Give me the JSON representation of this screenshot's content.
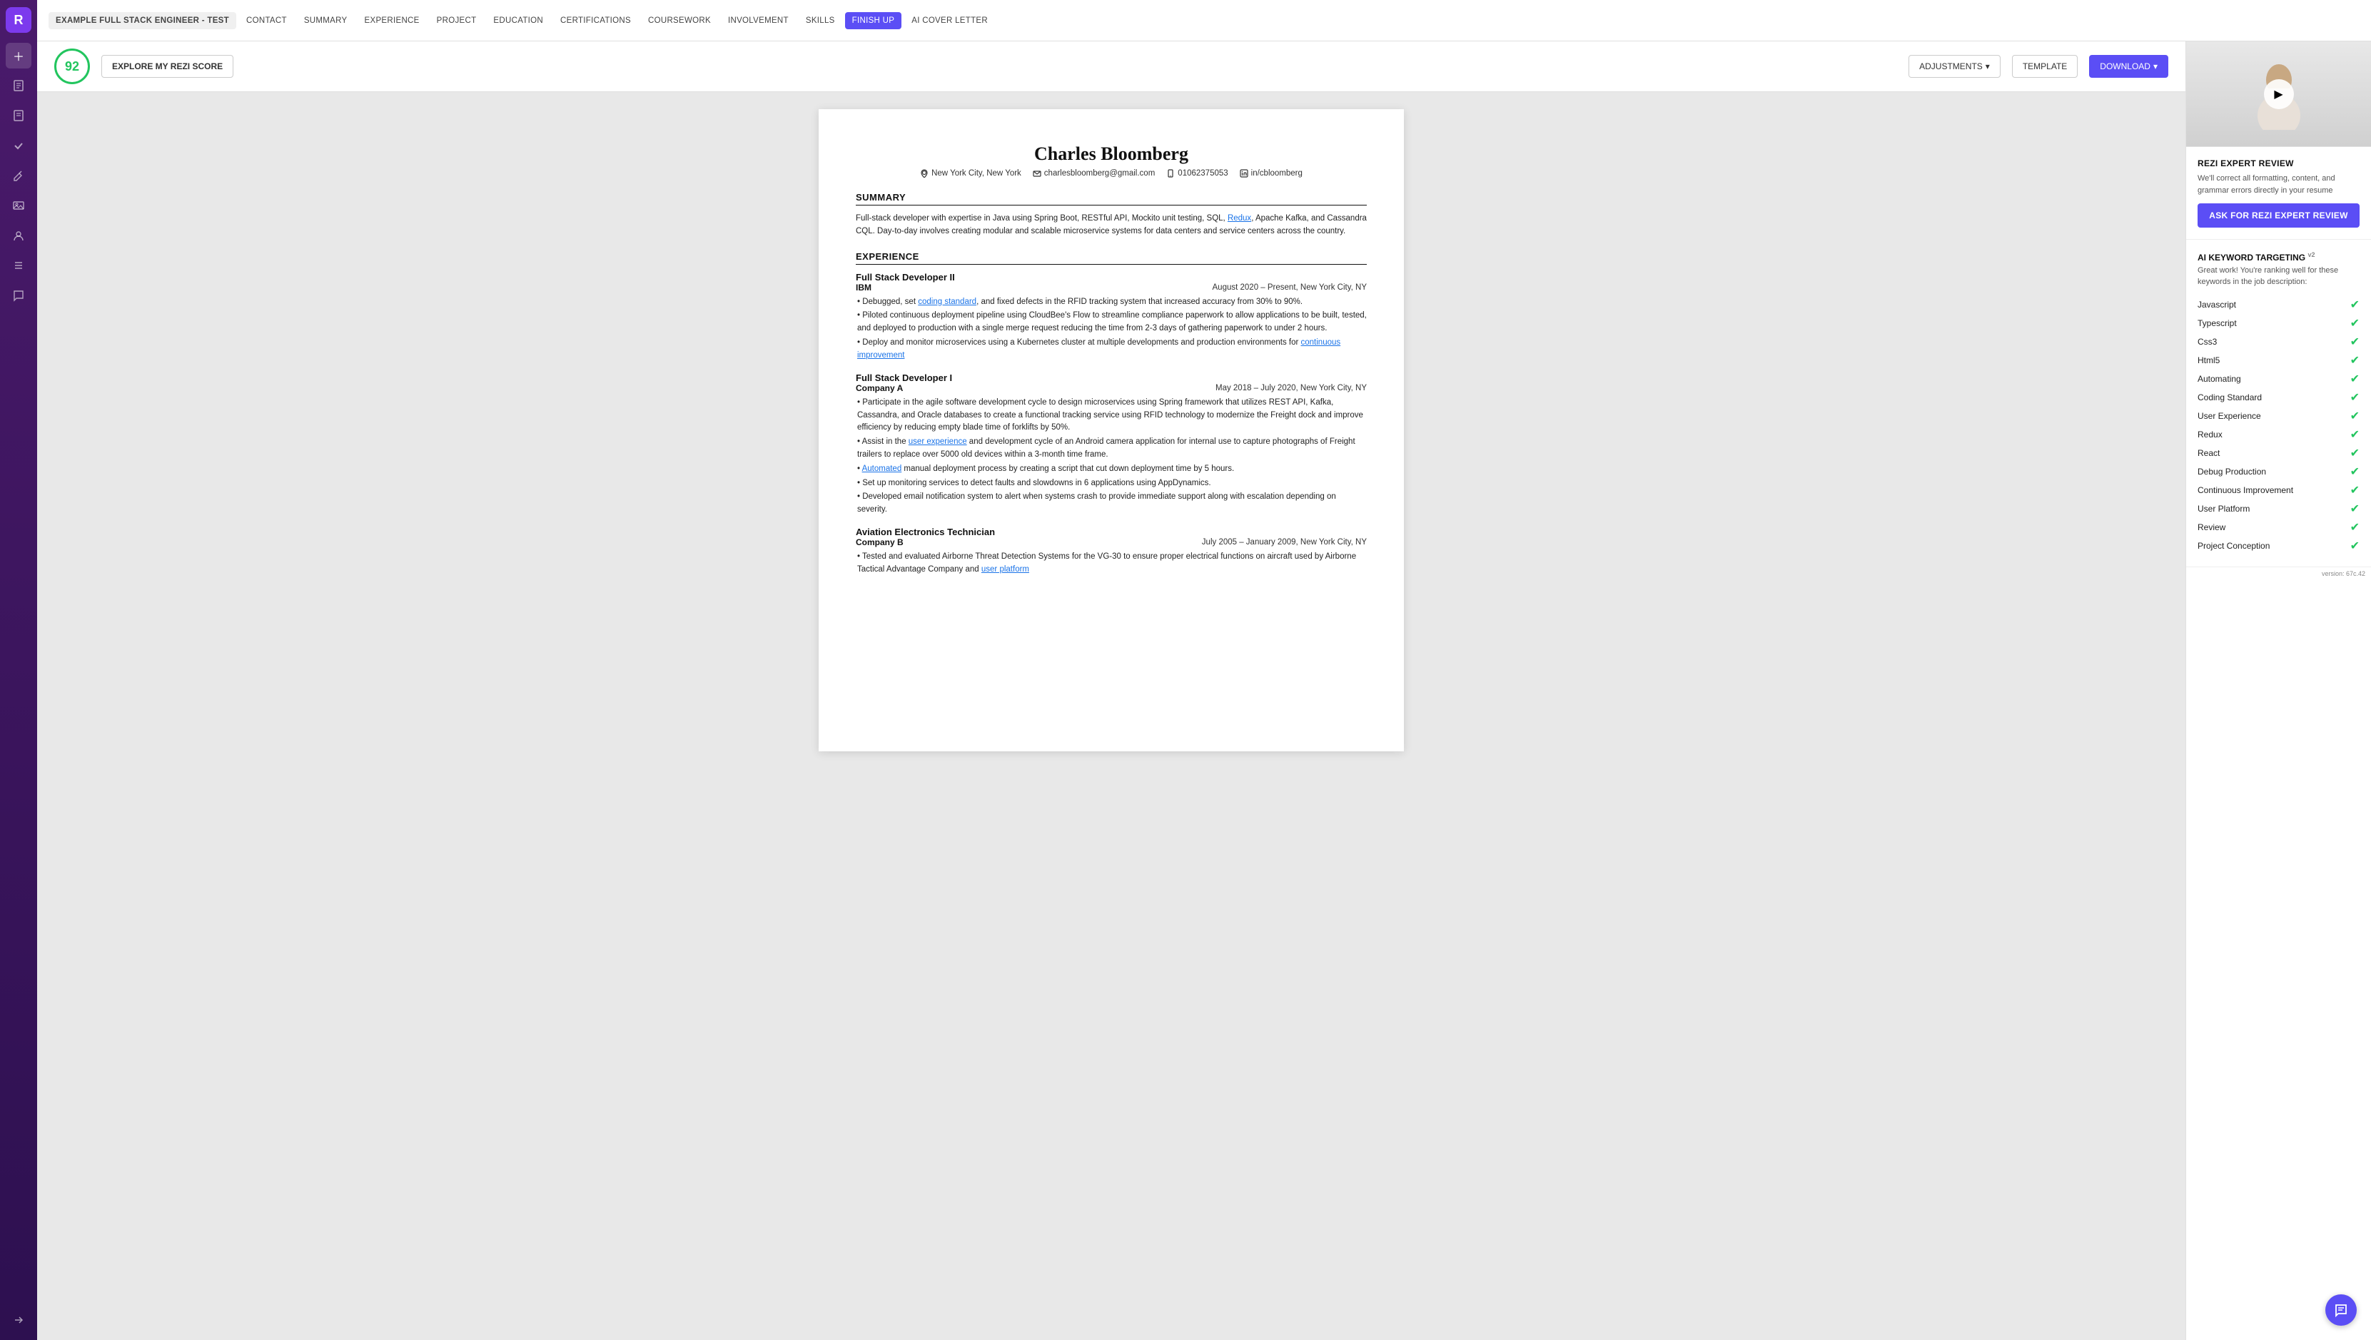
{
  "sidebar": {
    "logo": "R",
    "icons": [
      {
        "name": "plus-icon",
        "glyph": "+"
      },
      {
        "name": "document-icon",
        "glyph": "📄"
      },
      {
        "name": "document2-icon",
        "glyph": "📋"
      },
      {
        "name": "checkmark-icon",
        "glyph": "✓"
      },
      {
        "name": "edit-icon",
        "glyph": "✏️"
      },
      {
        "name": "image-icon",
        "glyph": "🖼"
      },
      {
        "name": "user-icon",
        "glyph": "👤"
      },
      {
        "name": "list-icon",
        "glyph": "☰"
      },
      {
        "name": "chat-icon",
        "glyph": "💬"
      },
      {
        "name": "arrow-icon",
        "glyph": "→"
      }
    ]
  },
  "topnav": {
    "items": [
      {
        "label": "EXAMPLE FULL STACK ENGINEER - TEST",
        "class": "active"
      },
      {
        "label": "CONTACT",
        "class": ""
      },
      {
        "label": "SUMMARY",
        "class": ""
      },
      {
        "label": "EXPERIENCE",
        "class": ""
      },
      {
        "label": "PROJECT",
        "class": ""
      },
      {
        "label": "EDUCATION",
        "class": ""
      },
      {
        "label": "CERTIFICATIONS",
        "class": ""
      },
      {
        "label": "COURSEWORK",
        "class": ""
      },
      {
        "label": "INVOLVEMENT",
        "class": ""
      },
      {
        "label": "SKILLS",
        "class": ""
      },
      {
        "label": "FINISH UP",
        "class": "finish-up"
      },
      {
        "label": "AI COVER LETTER",
        "class": ""
      }
    ]
  },
  "scorebar": {
    "score": "92",
    "explore_label": "EXPLORE MY REZI SCORE",
    "adjustments_label": "ADJUSTMENTS",
    "template_label": "TEMPLATE",
    "download_label": "DOWNLOAD"
  },
  "resume": {
    "name": "Charles Bloomberg",
    "location": "New York City, New York",
    "email": "charlesbloomberg@gmail.com",
    "phone": "01062375053",
    "linkedin": "in/cbloomberg",
    "summary_title": "SUMMARY",
    "summary_text": "Full-stack developer with expertise in Java using Spring Boot, RESTful API, Mockito unit testing, SQL, Redux, Apache Kafka, and Cassandra CQL. Day-to-day involves creating modular and scalable microservice systems for data centers and service centers across the country.",
    "experience_title": "EXPERIENCE",
    "jobs": [
      {
        "title": "Full Stack Developer II",
        "company": "IBM",
        "date": "August 2020 – Present, New York City, NY",
        "bullets": [
          "• Debugged, set coding standard, and fixed defects in the RFID tracking system that increased accuracy from 30% to 90%.",
          "• Piloted continuous deployment pipeline using CloudBee's Flow to streamline compliance paperwork to allow applications to be built, tested, and deployed to production with a single merge request reducing the time from 2-3 days of gathering paperwork to under 2 hours.",
          "• Deploy and monitor microservices using a Kubernetes cluster at multiple developments and production environments for continuous improvement"
        ]
      },
      {
        "title": "Full Stack Developer I",
        "company": "Company A",
        "date": "May 2018 – July 2020, New York City, NY",
        "bullets": [
          "• Participate in the agile software development cycle to design microservices using Spring framework that utilizes REST API, Kafka, Cassandra, and Oracle databases to create a functional tracking service using RFID technology to modernize the Freight dock and improve efficiency by reducing empty blade time of forklifts by 50%.",
          "• Assist in the user experience and development cycle of an Android camera application for internal use to capture photographs of Freight trailers to replace over 5000 old devices within a 3-month time frame.",
          "• Automated manual deployment process by creating a script that cut down deployment time by 5 hours.",
          "• Set up monitoring services to detect faults and slowdowns in 6 applications using AppDynamics.",
          "• Developed email notification system to alert when systems crash to provide immediate support along with escalation depending on severity."
        ]
      },
      {
        "title": "Aviation Electronics Technician",
        "company": "Company B",
        "date": "July 2005 – January 2009, New York City, NY",
        "bullets": [
          "• Tested and evaluated Airborne Threat Detection Systems for the VG-30 to ensure proper electrical functions on aircraft used by Airborne Tactical Advantage Company and user platform"
        ]
      }
    ]
  },
  "right_panel": {
    "rezi_expert_title": "REZI EXPERT REVIEW",
    "rezi_expert_desc": "We'll correct all formatting, content, and grammar errors directly in your resume",
    "ask_review_label": "ASK FOR REZI EXPERT REVIEW",
    "keyword_title": "AI KEYWORD TARGETING",
    "keyword_subtitle": "Great work! You're ranking well for these keywords in the job description:",
    "keywords": [
      {
        "name": "Javascript",
        "check": true
      },
      {
        "name": "Typescript",
        "check": true
      },
      {
        "name": "Css3",
        "check": true
      },
      {
        "name": "Html5",
        "check": true
      },
      {
        "name": "Automating",
        "check": true
      },
      {
        "name": "Coding Standard",
        "check": true
      },
      {
        "name": "User Experience",
        "check": true
      },
      {
        "name": "Redux",
        "check": true
      },
      {
        "name": "React",
        "check": true
      },
      {
        "name": "Debug Production",
        "check": true
      },
      {
        "name": "Continuous Improvement",
        "check": true
      },
      {
        "name": "User Platform",
        "check": true
      },
      {
        "name": "Review",
        "check": true
      },
      {
        "name": "Project Conception",
        "check": true
      }
    ]
  },
  "version": "version: 67c.42"
}
